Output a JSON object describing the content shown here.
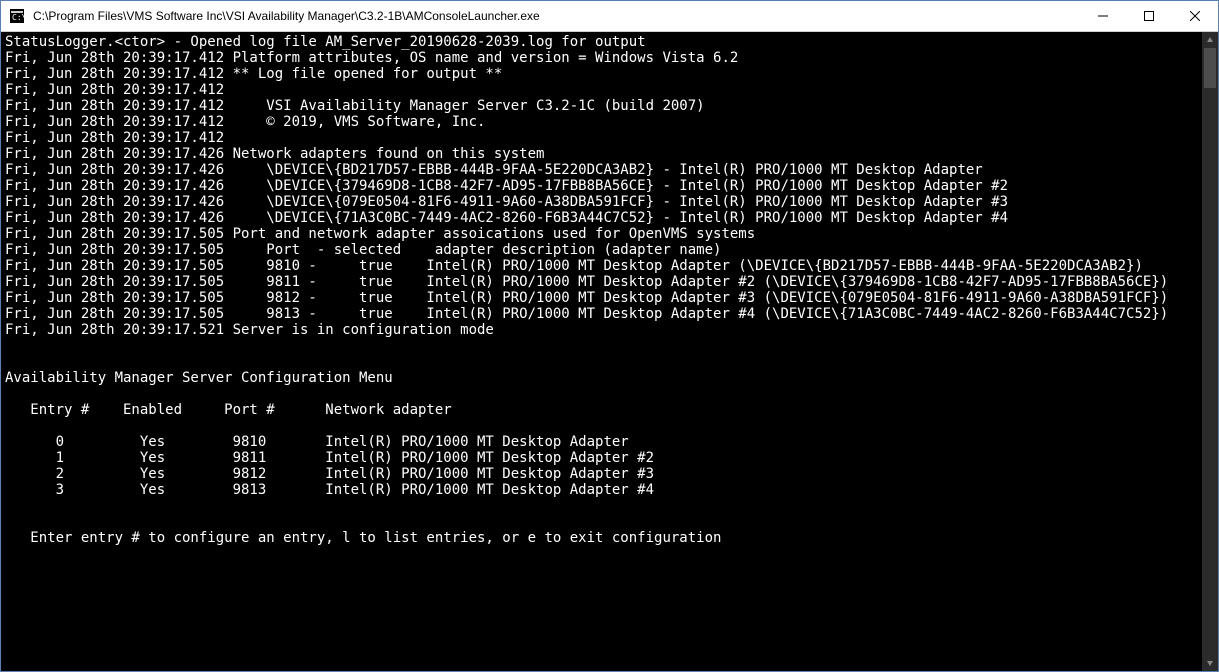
{
  "window": {
    "title": "C:\\Program Files\\VMS Software Inc\\VSI Availability Manager\\C3.2-1B\\AMConsoleLauncher.exe"
  },
  "console": {
    "lines": [
      "StatusLogger.<ctor> - Opened log file AM_Server_20190628-2039.log for output",
      "Fri, Jun 28th 20:39:17.412 Platform attributes, OS name and version = Windows Vista 6.2",
      "Fri, Jun 28th 20:39:17.412 ** Log file opened for output **",
      "Fri, Jun 28th 20:39:17.412",
      "Fri, Jun 28th 20:39:17.412     VSI Availability Manager Server C3.2-1C (build 2007)",
      "Fri, Jun 28th 20:39:17.412     © 2019, VMS Software, Inc.",
      "Fri, Jun 28th 20:39:17.412",
      "Fri, Jun 28th 20:39:17.426 Network adapters found on this system",
      "Fri, Jun 28th 20:39:17.426     \\DEVICE\\{BD217D57-EBBB-444B-9FAA-5E220DCA3AB2} - Intel(R) PRO/1000 MT Desktop Adapter",
      "Fri, Jun 28th 20:39:17.426     \\DEVICE\\{379469D8-1CB8-42F7-AD95-17FBB8BA56CE} - Intel(R) PRO/1000 MT Desktop Adapter #2",
      "Fri, Jun 28th 20:39:17.426     \\DEVICE\\{079E0504-81F6-4911-9A60-A38DBA591FCF} - Intel(R) PRO/1000 MT Desktop Adapter #3",
      "Fri, Jun 28th 20:39:17.426     \\DEVICE\\{71A3C0BC-7449-4AC2-8260-F6B3A44C7C52} - Intel(R) PRO/1000 MT Desktop Adapter #4",
      "Fri, Jun 28th 20:39:17.505 Port and network adapter assoications used for OpenVMS systems",
      "Fri, Jun 28th 20:39:17.505     Port  - selected    adapter description (adapter name)",
      "Fri, Jun 28th 20:39:17.505     9810 -     true    Intel(R) PRO/1000 MT Desktop Adapter (\\DEVICE\\{BD217D57-EBBB-444B-9FAA-5E220DCA3AB2})",
      "Fri, Jun 28th 20:39:17.505     9811 -     true    Intel(R) PRO/1000 MT Desktop Adapter #2 (\\DEVICE\\{379469D8-1CB8-42F7-AD95-17FBB8BA56CE})",
      "Fri, Jun 28th 20:39:17.505     9812 -     true    Intel(R) PRO/1000 MT Desktop Adapter #3 (\\DEVICE\\{079E0504-81F6-4911-9A60-A38DBA591FCF})",
      "Fri, Jun 28th 20:39:17.505     9813 -     true    Intel(R) PRO/1000 MT Desktop Adapter #4 (\\DEVICE\\{71A3C0BC-7449-4AC2-8260-F6B3A44C7C52})",
      "Fri, Jun 28th 20:39:17.521 Server is in configuration mode",
      "",
      "",
      "Availability Manager Server Configuration Menu",
      "",
      "   Entry #    Enabled     Port #      Network adapter",
      "",
      "      0         Yes        9810       Intel(R) PRO/1000 MT Desktop Adapter",
      "      1         Yes        9811       Intel(R) PRO/1000 MT Desktop Adapter #2",
      "      2         Yes        9812       Intel(R) PRO/1000 MT Desktop Adapter #3",
      "      3         Yes        9813       Intel(R) PRO/1000 MT Desktop Adapter #4",
      "",
      "",
      "   Enter entry # to configure an entry, l to list entries, or e to exit configuration"
    ]
  }
}
